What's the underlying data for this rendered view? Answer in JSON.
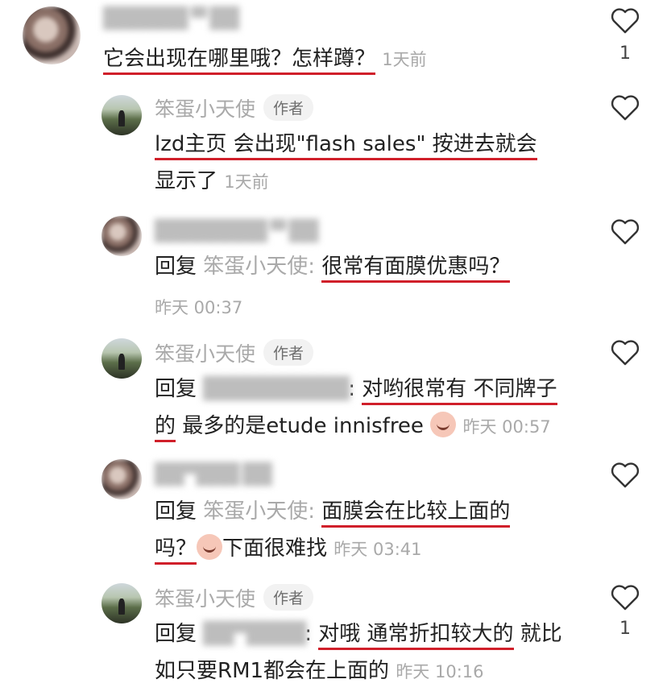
{
  "comments": [
    {
      "name": "",
      "text": "它会出现在哪里哦？怎样蹲？",
      "time": "1天前",
      "likes": "1"
    },
    {
      "name": "笨蛋小天使",
      "badge": "作者",
      "text_line1": "lzd主页 会出现\"flash sales\" 按进去就会",
      "text_line2": "显示了",
      "time": "1天前"
    },
    {
      "name": "",
      "reply_prefix": "回复",
      "reply_to": "笨蛋小天使:",
      "text": "很常有面膜优惠吗？",
      "time": "昨天 00:37"
    },
    {
      "name": "笨蛋小天使",
      "badge": "作者",
      "reply_prefix": "回复",
      "reply_to": ":",
      "text_a": "对哟很常有 不同牌子",
      "text_b": "的",
      "text_c": " 最多的是etude innisfree",
      "time": "昨天 00:57"
    },
    {
      "name": "",
      "reply_prefix": "回复",
      "reply_to": "笨蛋小天使:",
      "text_a": "面膜会在比较上面的",
      "text_b": "吗？",
      "text_c": "下面很难找",
      "time": "昨天 03:41"
    },
    {
      "name": "笨蛋小天使",
      "badge": "作者",
      "reply_prefix": "回复",
      "reply_to": ":",
      "text_a": "对哦 通常折扣较大的",
      "text_b": " 就比",
      "text_c": "如只要RM1都会在上面的",
      "time": "昨天 10:16",
      "likes": "1"
    }
  ]
}
